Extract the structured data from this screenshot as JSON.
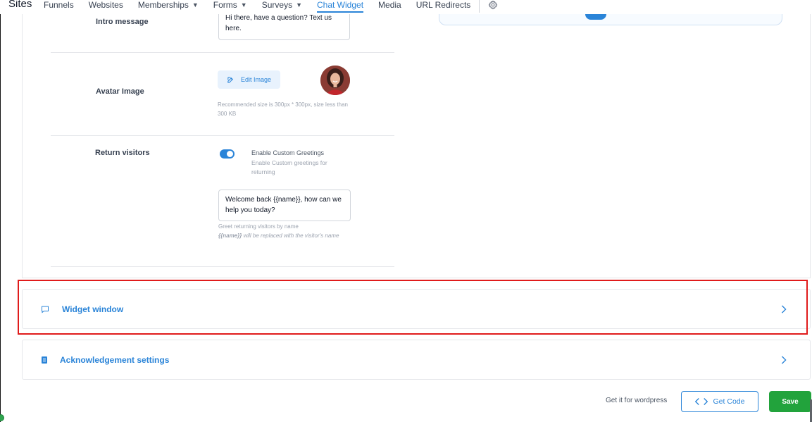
{
  "nav": {
    "brand": "Sites",
    "items": [
      {
        "label": "Funnels",
        "dropdown": false
      },
      {
        "label": "Websites",
        "dropdown": false
      },
      {
        "label": "Memberships",
        "dropdown": true
      },
      {
        "label": "Forms",
        "dropdown": true
      },
      {
        "label": "Surveys",
        "dropdown": true
      },
      {
        "label": "Chat Widget",
        "dropdown": false,
        "active": true
      },
      {
        "label": "Media",
        "dropdown": false
      },
      {
        "label": "URL Redirects",
        "dropdown": false
      }
    ],
    "settings_icon": "gear-icon"
  },
  "intro": {
    "label": "Intro message",
    "value": "Hi there, have a question? Text us here."
  },
  "avatar": {
    "label": "Avatar Image",
    "edit_button": "Edit Image",
    "help": "Recommended size is 300px * 300px, size less than 300 KB"
  },
  "return_visitors": {
    "label": "Return visitors",
    "toggle_title": "Enable Custom Greetings",
    "toggle_desc": "Enable Custom greetings for returning",
    "toggle_on": true,
    "greeting": "Welcome back {{name}}, how can we help you today?",
    "help_line1": "Greet returning visitors by name",
    "help_token": "{{name}}",
    "help_line2": " will be replaced with the visitor's name"
  },
  "sections": [
    {
      "label": "Widget window",
      "icon": "chat-bubble-icon"
    },
    {
      "label": "Acknowledgement settings",
      "icon": "document-icon"
    }
  ],
  "footer": {
    "wordpress_text": "Get it for wordpress",
    "get_code": "Get Code",
    "save": "Save"
  },
  "colors": {
    "accent": "#2a84d8",
    "save": "#22a33c",
    "highlight": "#e01b1b"
  }
}
